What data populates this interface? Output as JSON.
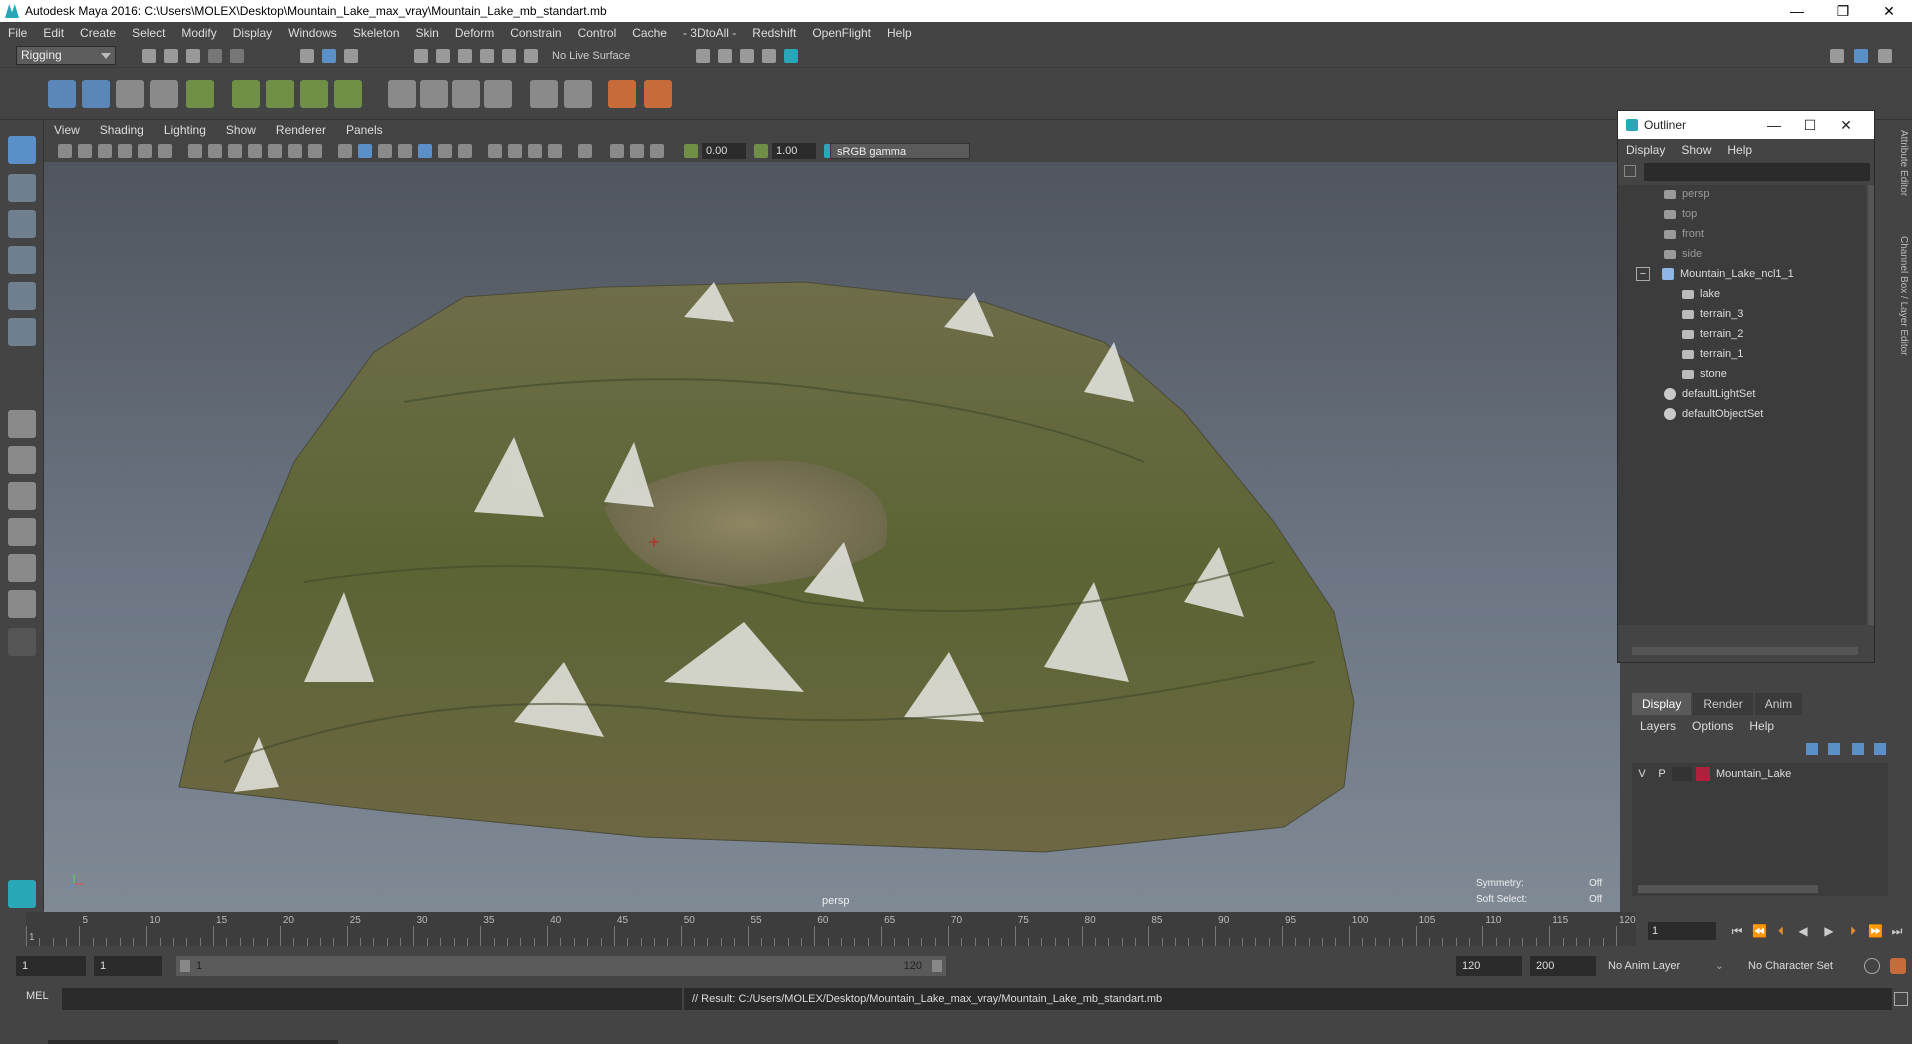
{
  "window": {
    "title": "Autodesk Maya 2016: C:\\Users\\MOLEX\\Desktop\\Mountain_Lake_max_vray\\Mountain_Lake_mb_standart.mb",
    "minimize": "—",
    "restore": "❐",
    "close": "✕"
  },
  "menubar": [
    "File",
    "Edit",
    "Create",
    "Select",
    "Modify",
    "Display",
    "Windows",
    "Skeleton",
    "Skin",
    "Deform",
    "Constrain",
    "Control",
    "Cache",
    "- 3DtoAll -",
    "Redshift",
    "OpenFlight",
    "Help"
  ],
  "statusline": {
    "mode": "Rigging",
    "live_surface": "No Live Surface"
  },
  "panel": {
    "menu": [
      "View",
      "Shading",
      "Lighting",
      "Show",
      "Renderer",
      "Panels"
    ],
    "exposure": "0.00",
    "gamma_value": "1.00",
    "color_space": "sRGB gamma"
  },
  "viewport": {
    "camera_label": "persp",
    "symmetry_label": "Symmetry:",
    "symmetry_value": "Off",
    "soft_select_label": "Soft Select:",
    "soft_select_value": "Off"
  },
  "outliner": {
    "title": "Outliner",
    "menu": [
      "Display",
      "Show",
      "Help"
    ],
    "items": [
      {
        "label": "persp",
        "icon": "camera-icon"
      },
      {
        "label": "top",
        "icon": "camera-icon"
      },
      {
        "label": "front",
        "icon": "camera-icon"
      },
      {
        "label": "side",
        "icon": "camera-icon"
      },
      {
        "label": "Mountain_Lake_ncl1_1",
        "icon": "transform-icon",
        "collapse": "−"
      },
      {
        "label": "lake",
        "icon": "mesh-icon"
      },
      {
        "label": "terrain_3",
        "icon": "mesh-icon"
      },
      {
        "label": "terrain_2",
        "icon": "mesh-icon"
      },
      {
        "label": "terrain_1",
        "icon": "mesh-icon"
      },
      {
        "label": "stone",
        "icon": "mesh-icon"
      },
      {
        "label": "defaultLightSet",
        "icon": "set-icon"
      },
      {
        "label": "defaultObjectSet",
        "icon": "set-icon"
      }
    ]
  },
  "side_tabs": {
    "attribute_editor": "Attribute Editor",
    "channel_box": "Channel Box / Layer Editor"
  },
  "layer_editor": {
    "tabs": [
      "Display",
      "Render",
      "Anim"
    ],
    "menu": [
      "Layers",
      "Options",
      "Help"
    ],
    "layer": {
      "v": "V",
      "p": "P",
      "name": "Mountain_Lake",
      "color": "#b01f3b"
    }
  },
  "timeline": {
    "ticks": [
      "1",
      "5",
      "10",
      "15",
      "20",
      "25",
      "30",
      "35",
      "40",
      "45",
      "50",
      "55",
      "60",
      "65",
      "70",
      "75",
      "80",
      "85",
      "90",
      "95",
      "100",
      "105",
      "110",
      "115",
      "120"
    ],
    "current_frame": "1"
  },
  "range": {
    "start": "1",
    "playback_start": "1",
    "slider_start": "1",
    "slider_end": "120",
    "playback_end": "120",
    "end": "200",
    "anim_layer": "No Anim Layer",
    "character_set": "No Character Set"
  },
  "command_line": {
    "language": "MEL",
    "result": "// Result: C:/Users/MOLEX/Desktop/Mountain_Lake_max_vray/Mountain_Lake_mb_standart.mb"
  }
}
